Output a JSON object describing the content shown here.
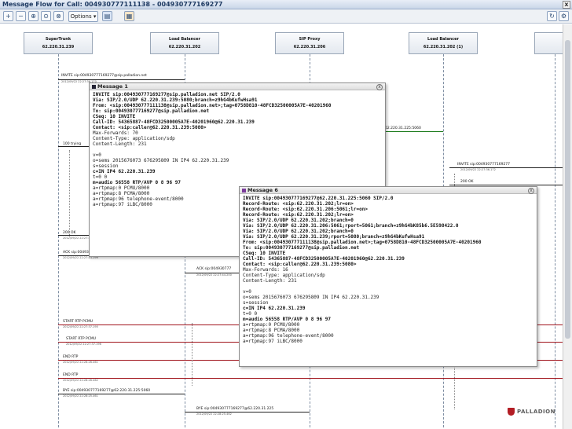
{
  "window": {
    "title": "Message Flow for Call: 004930777111138 - 004930777169277",
    "close_label": "x"
  },
  "toolbar": {
    "options_label": "Options ▾",
    "buttons": [
      "zoom-in",
      "zoom-out",
      "zoom-fit",
      "zoom-reset",
      "export",
      "print"
    ]
  },
  "entities": [
    {
      "name": "SuperTrunk",
      "ip": "62.220.31.239"
    },
    {
      "name": "Load Balancer",
      "ip": "62.220.31.202"
    },
    {
      "name": "SIP Proxy",
      "ip": "62.220.31.206"
    },
    {
      "name": "Load Balancer",
      "ip": "62.220.31.202 (1)"
    }
  ],
  "messages": [
    {
      "label": "INVITE sip:004930777169277@sip.palladion.net",
      "time": "2012/09/22 22:27:36.170"
    },
    {
      "label": "100 trying",
      "time": ""
    },
    {
      "label": "62.220.31.225:5060",
      "time": ""
    },
    {
      "label": "INVITE sip:004930777169277",
      "time": "2012/09/22 22:27:36.172"
    },
    {
      "label": "200 OK",
      "time": ""
    },
    {
      "label": "200 OK",
      "time": "2012/09/22 22:27:44.197"
    },
    {
      "label": "ACK sip:004930777169277@62.220.31.225:5060",
      "time": "2012/09/22 22:27:44.199"
    },
    {
      "label": "ACK sip:004930777",
      "time": "2012/09/22 22:27:44.200"
    },
    {
      "label": "START RTP PCMU",
      "time": "2012/09/22 22:27:37.195"
    },
    {
      "label": "START RTP PCMU",
      "time": "2012/09/22 22:27:37.196"
    },
    {
      "label": "END RTP",
      "time": "2012/09/22 22:28:26.461"
    },
    {
      "label": "END RTP",
      "time": "2012/09/22 22:28:26.462"
    },
    {
      "label": "BYE sip:004930777169277@62.220.31.225:5060",
      "time": "2012/09/22 22:28:25.461"
    },
    {
      "label": "BYE sip:004930777169277@62.220.31.225",
      "time": "2012/09/22 22:28:25.462"
    }
  ],
  "popup1": {
    "title": "Message 1",
    "close": "x",
    "lines": [
      "INVITE sip:004930777169277@sip.palladion.net SIP/2.0",
      "Via: SIP/2.0/UDP 62.220.31.239:5080;branch=z9hG4bKufwHsa91",
      "From: <sip:004930777111138@sip.palladion.net>;tag=0758D810-48FCD32500005A7E-40201960",
      "To: sip:004930777169277@sip.palladion.net",
      "CSeq: 10 INVITE",
      "Call-ID: 54365887-48FCD32500005A7E-40201960@62.220.31.239",
      "Contact: <sip:caller@62.220.31.239:5080>",
      "Max-Forwards: 70",
      "Content-Type: application/sdp",
      "Content-Length: 231",
      "",
      "v=0",
      "o=sems 2015676073 676295809 IN IP4 62.220.31.239",
      "s=session",
      "c=IN IP4 62.220.31.239",
      "t=0 0",
      "m=audio 56558 RTP/AVP 0 8 96 97",
      "a=rtpmap:0 PCMU/8000",
      "a=rtpmap:8 PCMA/8000",
      "a=rtpmap:96 telephone-event/8000",
      "a=rtpmap:97 iLBC/8000"
    ]
  },
  "popup6": {
    "title": "Message 6",
    "close": "x",
    "lines": [
      "INVITE sip:004930777169277@62.220.31.225:5060 SIP/2.0",
      "Record-Route: <sip:62.220.31.202;lr=on>",
      "Record-Route: <sip:62.220.31.206:5061;lr=on>",
      "Record-Route: <sip:62.220.31.202;lr=on>",
      "Via: SIP/2.0/UDP 62.220.31.202;branch=0",
      "Via: SIP/2.0/UDP 62.220.31.206:5061;rport=5061;branch=z9hG4bK85b6.5E598422.0",
      "Via: SIP/2.0/UDP 62.220.31.202;branch=0",
      "Via: SIP/2.0/UDP 62.220.31.239;rport=5080;branch=z9hG4bKufwHsa91",
      "From: <sip:004930777111138@sip.palladion.net>;tag=0758D810-48FCD32500005A7E-40201960",
      "To: sip:004930777169277@sip.palladion.net",
      "CSeq: 10 INVITE",
      "Call-ID: 54365887-48FCD32500005A7E-40201960@62.220.31.239",
      "Contact: <sip:caller@62.220.31.239:5080>",
      "Max-Forwards: 16",
      "Content-Type: application/sdp",
      "Content-Length: 231",
      "",
      "v=0",
      "o=sems 2015676073 676295809 IN IP4 62.220.31.239",
      "s=session",
      "c=IN IP4 62.220.31.239",
      "t=0 0",
      "m=audio 56558 RTP/AVP 0 8 96 97",
      "a=rtpmap:0 PCMU/8000",
      "a=rtpmap:8 PCMA/8000",
      "a=rtpmap:96 telephone-event/8000",
      "a=rtpmap:97 iLBC/8000"
    ]
  },
  "logo": {
    "text": "PALLADION"
  }
}
